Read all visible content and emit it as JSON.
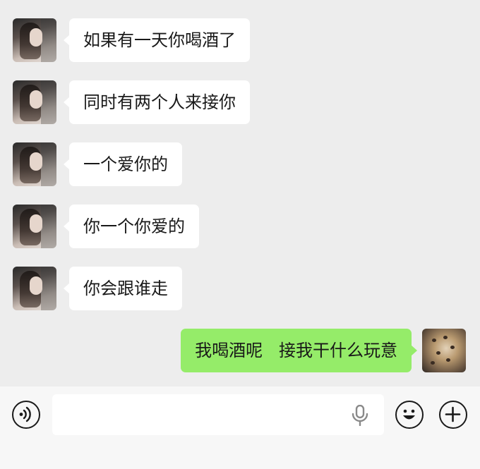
{
  "chat": {
    "received": [
      {
        "text": "如果有一天你喝酒了"
      },
      {
        "text": "同时有两个人来接你"
      },
      {
        "text": "一个爱你的"
      },
      {
        "text": "你一个你爱的"
      },
      {
        "text": "你会跟谁走"
      }
    ],
    "sent": [
      {
        "text": "我喝酒呢   接我干什么玩意"
      }
    ]
  },
  "input_bar": {
    "value": "",
    "icons": {
      "voice": "voice-toggle-icon",
      "mic": "microphone-icon",
      "emoji": "emoji-icon",
      "more": "plus-icon"
    }
  },
  "colors": {
    "chat_background": "#ededed",
    "received_bubble": "#ffffff",
    "sent_bubble": "#95ec69",
    "input_bar_background": "#f7f7f7"
  }
}
